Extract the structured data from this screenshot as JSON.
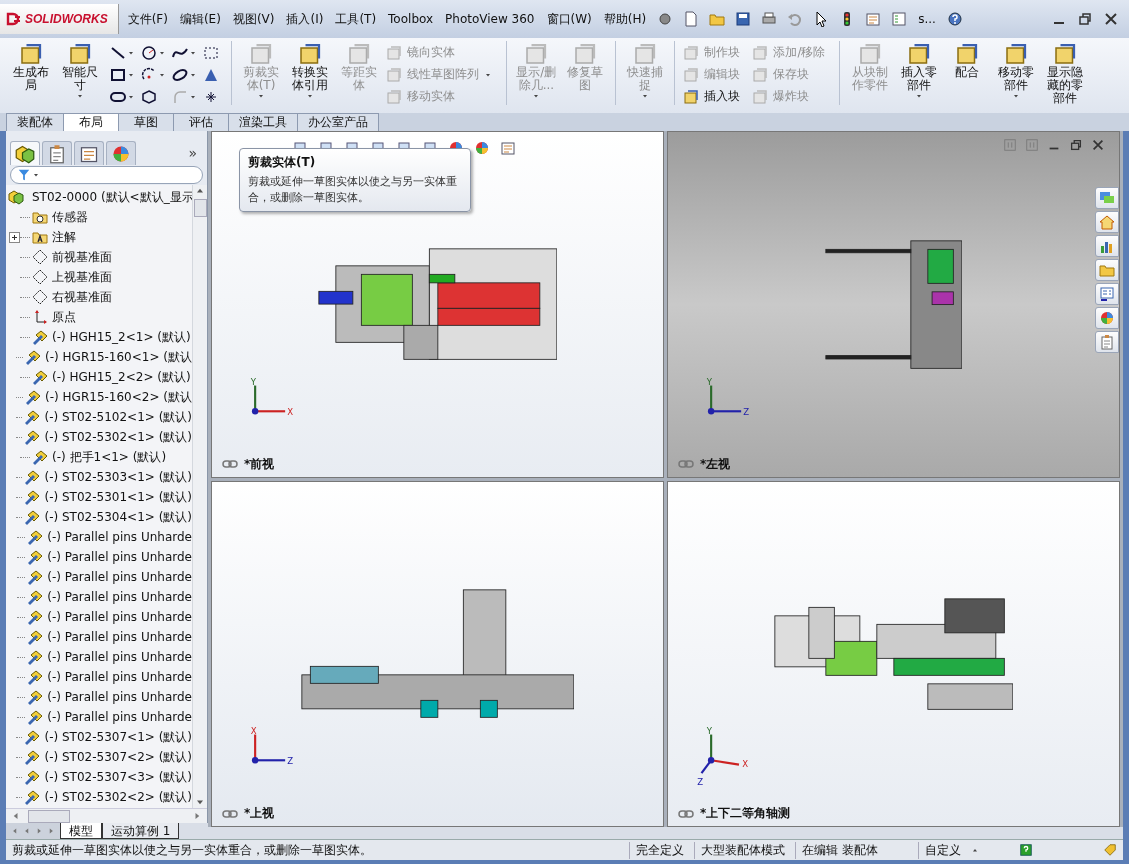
{
  "app": {
    "logo": "SOLIDWORKS",
    "menus": [
      "文件(F)",
      "编辑(E)",
      "视图(V)",
      "插入(I)",
      "工具(T)",
      "Toolbox",
      "PhotoView 360",
      "窗口(W)",
      "帮助(H)"
    ],
    "overflow": "s..."
  },
  "ribbon": [
    {
      "kind": "large",
      "label": "生成布局",
      "disabled": false,
      "dropdown": false
    },
    {
      "kind": "large",
      "label": "智能尺寸",
      "disabled": false,
      "dropdown": true
    },
    {
      "kind": "sketch_tools"
    },
    {
      "kind": "separator"
    },
    {
      "kind": "large",
      "label": "剪裁实体(T)",
      "disabled": true,
      "dropdown": true
    },
    {
      "kind": "large",
      "label": "转换实体引用",
      "disabled": false,
      "dropdown": true
    },
    {
      "kind": "large",
      "label": "等距实体",
      "disabled": true,
      "dropdown": false
    },
    {
      "kind": "stack",
      "items": [
        {
          "label": "镜向实体",
          "disabled": true,
          "dropdown": false
        },
        {
          "label": "线性草图阵列",
          "disabled": true,
          "dropdown": true
        },
        {
          "label": "移动实体",
          "disabled": true,
          "dropdown": false
        }
      ]
    },
    {
      "kind": "separator"
    },
    {
      "kind": "large",
      "label": "显示/删除几...",
      "disabled": true,
      "dropdown": true
    },
    {
      "kind": "large",
      "label": "修复草图",
      "disabled": true,
      "dropdown": false
    },
    {
      "kind": "separator"
    },
    {
      "kind": "large",
      "label": "快速捕捉",
      "disabled": true,
      "dropdown": true
    },
    {
      "kind": "separator"
    },
    {
      "kind": "stack",
      "items": [
        {
          "label": "制作块",
          "disabled": true,
          "dropdown": false
        },
        {
          "label": "编辑块",
          "disabled": true,
          "dropdown": false
        },
        {
          "label": "插入块",
          "disabled": false,
          "dropdown": false
        }
      ]
    },
    {
      "kind": "stack",
      "items": [
        {
          "label": "添加/移除",
          "disabled": true,
          "dropdown": false
        },
        {
          "label": "保存块",
          "disabled": true,
          "dropdown": false
        },
        {
          "label": "爆炸块",
          "disabled": true,
          "dropdown": false
        }
      ]
    },
    {
      "kind": "separator"
    },
    {
      "kind": "large",
      "label": "从块制作零件",
      "disabled": true,
      "dropdown": false
    },
    {
      "kind": "large",
      "label": "插入零部件",
      "disabled": false,
      "dropdown": true
    },
    {
      "kind": "large",
      "label": "配合",
      "disabled": false,
      "dropdown": false
    },
    {
      "kind": "large",
      "label": "移动零部件",
      "disabled": false,
      "dropdown": true
    },
    {
      "kind": "large",
      "label": "显示隐藏的零部件",
      "disabled": false,
      "dropdown": false
    }
  ],
  "command_tabs": [
    {
      "label": "装配体",
      "selected": false
    },
    {
      "label": "布局",
      "selected": true
    },
    {
      "label": "草图",
      "selected": false
    },
    {
      "label": "评估",
      "selected": false
    },
    {
      "label": "渲染工具",
      "selected": false
    },
    {
      "label": "办公室产品",
      "selected": false
    }
  ],
  "feature_manager": {
    "panel_tabs": [
      {
        "selected": true
      },
      {
        "selected": false
      },
      {
        "selected": false
      },
      {
        "selected": false
      }
    ],
    "more": "»",
    "tree": {
      "label": "ST02-0000 (默认<默认_显示",
      "kind": "assembly",
      "children": [
        {
          "label": "传感器",
          "kind": "sensor"
        },
        {
          "label": "注解",
          "kind": "annotation",
          "expanded": false
        },
        {
          "label": "前视基准面",
          "kind": "plane"
        },
        {
          "label": "上视基准面",
          "kind": "plane"
        },
        {
          "label": "右视基准面",
          "kind": "plane"
        },
        {
          "label": "原点",
          "kind": "origin"
        },
        {
          "label": "(-) HGH15_2<1> (默认)",
          "kind": "part"
        },
        {
          "label": "(-) HGR15-160<1> (默认",
          "kind": "part"
        },
        {
          "label": "(-) HGH15_2<2> (默认)",
          "kind": "part"
        },
        {
          "label": "(-) HGR15-160<2> (默认",
          "kind": "part"
        },
        {
          "label": "(-) ST02-5102<1> (默认)",
          "kind": "part"
        },
        {
          "label": "(-) ST02-5302<1> (默认)",
          "kind": "part"
        },
        {
          "label": "(-) 把手1<1> (默认)",
          "kind": "part"
        },
        {
          "label": "(-) ST02-5303<1> (默认)",
          "kind": "part"
        },
        {
          "label": "(-) ST02-5301<1> (默认)",
          "kind": "part"
        },
        {
          "label": "(-) ST02-5304<1> (默认)",
          "kind": "part"
        },
        {
          "label": "(-) Parallel pins Unharde",
          "kind": "part"
        },
        {
          "label": "(-) Parallel pins Unharde",
          "kind": "part"
        },
        {
          "label": "(-) Parallel pins Unharde",
          "kind": "part"
        },
        {
          "label": "(-) Parallel pins Unharde",
          "kind": "part"
        },
        {
          "label": "(-) Parallel pins Unharde",
          "kind": "part"
        },
        {
          "label": "(-) Parallel pins Unharde",
          "kind": "part"
        },
        {
          "label": "(-) Parallel pins Unharde",
          "kind": "part"
        },
        {
          "label": "(-) Parallel pins Unharde",
          "kind": "part"
        },
        {
          "label": "(-) Parallel pins Unharde",
          "kind": "part"
        },
        {
          "label": "(-) Parallel pins Unharde",
          "kind": "part"
        },
        {
          "label": "(-) ST02-5307<1> (默认)",
          "kind": "part"
        },
        {
          "label": "(-) ST02-5307<2> (默认)",
          "kind": "part"
        },
        {
          "label": "(-) ST02-5307<3> (默认)",
          "kind": "part"
        },
        {
          "label": "(-) ST02-5302<2> (默认)",
          "kind": "part"
        }
      ]
    },
    "bottom_tabs": [
      {
        "label": "模型",
        "selected": true
      },
      {
        "label": "运动算例 1",
        "selected": false
      }
    ]
  },
  "viewports": [
    {
      "label": "*前视",
      "axes": [
        "Y",
        "X"
      ]
    },
    {
      "label": "*左视",
      "axes": [
        "Y",
        "Z"
      ]
    },
    {
      "label": "*上视",
      "axes": [
        "X",
        "Z"
      ]
    },
    {
      "label": "*上下二等角轴测",
      "axes": [
        "Y",
        "X",
        "Z"
      ]
    }
  ],
  "tooltip": {
    "title": "剪裁实体(T)",
    "text": "剪裁或延伸一草图实体以使之与另一实体重合，或删除一草图实体。"
  },
  "status_bar": {
    "message": "剪裁或延伸一草图实体以使之与另一实体重合，或删除一草图实体。",
    "items": [
      "完全定义",
      "大型装配体模式",
      "在编辑 装配体"
    ],
    "units": "自定义"
  }
}
